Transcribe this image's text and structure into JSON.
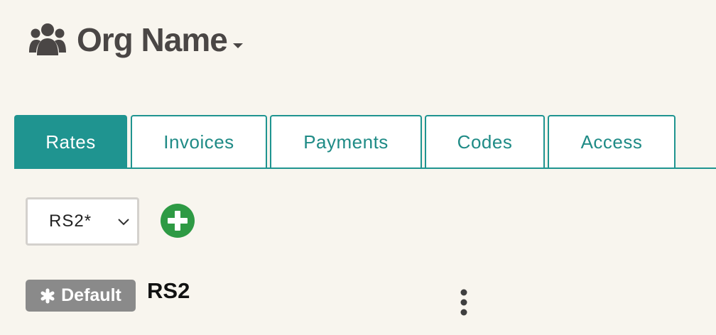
{
  "header": {
    "org_name": "Org Name",
    "icon": "users-icon"
  },
  "tabs": [
    {
      "label": "Rates",
      "active": true
    },
    {
      "label": "Invoices",
      "active": false
    },
    {
      "label": "Payments",
      "active": false
    },
    {
      "label": "Codes",
      "active": false
    },
    {
      "label": "Access",
      "active": false
    }
  ],
  "rate_set_select": {
    "value": "RS2*"
  },
  "rate": {
    "badge_label": "Default",
    "name": "RS2"
  },
  "colors": {
    "accent": "#1f9490",
    "add_button": "#2e9a44",
    "badge": "#8a8a8a",
    "background": "#f8f5ee"
  }
}
